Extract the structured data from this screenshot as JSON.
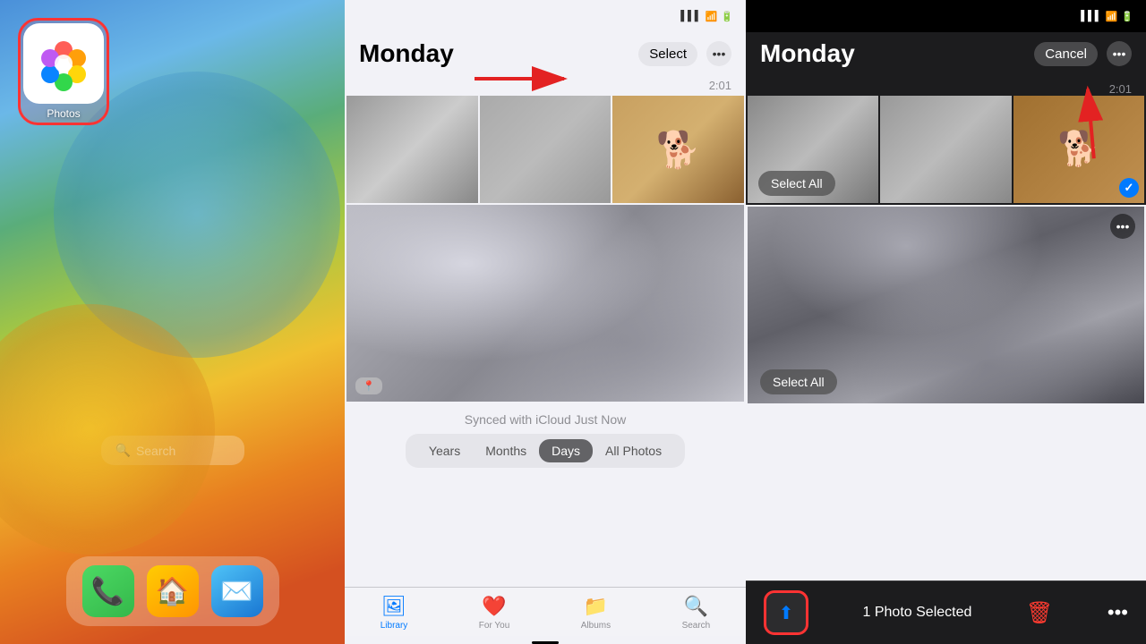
{
  "panel1": {
    "app_label": "Photos",
    "search_label": "🔍 Search"
  },
  "panel2": {
    "title": "Monday",
    "select_btn": "Select",
    "more_btn": "•••",
    "timestamp": "2:01",
    "synced_text": "Synced with iCloud Just Now",
    "filter_tabs": [
      "Years",
      "Months",
      "Days",
      "All Photos"
    ],
    "active_filter": "Days",
    "bottom_tabs": [
      {
        "label": "Library",
        "icon": "🖼",
        "active": true
      },
      {
        "label": "For You",
        "icon": "❤️",
        "active": false
      },
      {
        "label": "Albums",
        "icon": "📁",
        "active": false
      },
      {
        "label": "Search",
        "icon": "🔍",
        "active": false
      }
    ]
  },
  "panel3": {
    "title": "Monday",
    "cancel_btn": "Cancel",
    "more_btn": "•••",
    "timestamp": "2:01",
    "select_all_top": "Select All",
    "select_all_bottom": "Select All",
    "selected_count": "1 Photo Selected",
    "more_dots": "•••"
  }
}
